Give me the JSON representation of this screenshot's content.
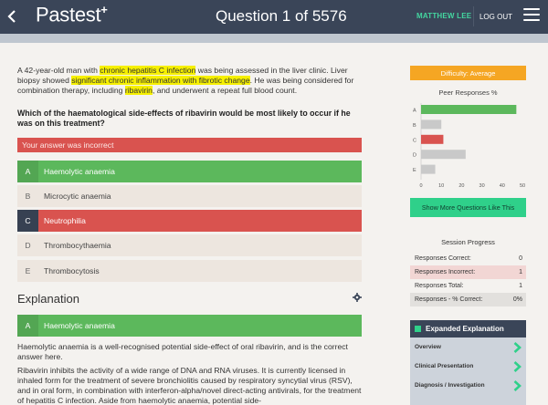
{
  "header": {
    "logo": "Pastest",
    "title": "Question 1 of 5576",
    "user": "MATTHEW LEE",
    "logout": "LOG OUT"
  },
  "question": {
    "stem_parts": [
      {
        "text": "A 42-year-old man with ",
        "hl": false
      },
      {
        "text": "chronic hepatitis C infection",
        "hl": true
      },
      {
        "text": " was being assessed in the liver clinic. Liver biopsy showed ",
        "hl": false
      },
      {
        "text": "significant chronic inflammation with fibrotic change",
        "hl": true
      },
      {
        "text": ". He was being considered for combination therapy, including ",
        "hl": false
      },
      {
        "text": "ribavirin",
        "hl": true
      },
      {
        "text": ", and underwent a repeat full blood count.",
        "hl": false
      }
    ],
    "prompt": "Which of the haematological side-effects of ribavirin would be most likely to occur if he was on this treatment?",
    "result": "Your answer was incorrect",
    "answers": [
      {
        "letter": "A",
        "text": "Haemolytic anaemia",
        "state": "correct"
      },
      {
        "letter": "B",
        "text": "Microcytic anaemia",
        "state": "none"
      },
      {
        "letter": "C",
        "text": "Neutrophilia",
        "state": "wrong"
      },
      {
        "letter": "D",
        "text": "Thrombocythaemia",
        "state": "none"
      },
      {
        "letter": "E",
        "text": "Thrombocytosis",
        "state": "none"
      }
    ]
  },
  "explanation": {
    "heading": "Explanation",
    "answer_letter": "A",
    "answer_text": "Haemolytic anaemia",
    "p1": "Haemolytic anaemia is a well-recognised potential side-effect of oral ribavirin, and is the correct answer here.",
    "p2": "Ribavirin inhibits the activity of a wide range of DNA and RNA viruses. It is currently licensed in inhaled form for the treatment of severe bronchiolitis caused by respiratory syncytial virus (RSV), and in oral form, in combination with interferon-alpha/novel direct-acting antivirals, for the treatment of hepatitis C infection. Aside from haemolytic anaemia, potential side-"
  },
  "sidebar": {
    "difficulty": "Difficulty: Average",
    "peer_title": "Peer Responses %",
    "more_button": "Show More Questions Like This",
    "progress_title": "Session Progress",
    "progress": [
      {
        "label": "Responses Correct:",
        "value": "0",
        "style": "plain"
      },
      {
        "label": "Responses Incorrect:",
        "value": "1",
        "style": "pink"
      },
      {
        "label": "Responses Total:",
        "value": "1",
        "style": "plain"
      },
      {
        "label": "Responses - % Correct:",
        "value": "0%",
        "style": "grey"
      }
    ],
    "expanded_title": "Expanded Explanation",
    "expanded_items": [
      "Overview",
      "Clinical Presentation",
      "Diagnosis / Investigation"
    ]
  },
  "chart_data": {
    "type": "bar",
    "orientation": "horizontal",
    "title": "Peer Responses %",
    "categories": [
      "A",
      "B",
      "C",
      "D",
      "E"
    ],
    "values": [
      47,
      10,
      11,
      22,
      7
    ],
    "xlim": [
      0,
      50
    ],
    "xticks": [
      0,
      10,
      20,
      30,
      40,
      50
    ],
    "colors": [
      "#5cb85c",
      "#c9c9c9",
      "#d9534f",
      "#c9c9c9",
      "#c9c9c9"
    ],
    "grid": false
  },
  "colors": {
    "header_bg": "#3a4558",
    "correct": "#5cb85c",
    "incorrect": "#d9534f",
    "difficulty": "#f5a623",
    "accent_green": "#2fd08a"
  }
}
